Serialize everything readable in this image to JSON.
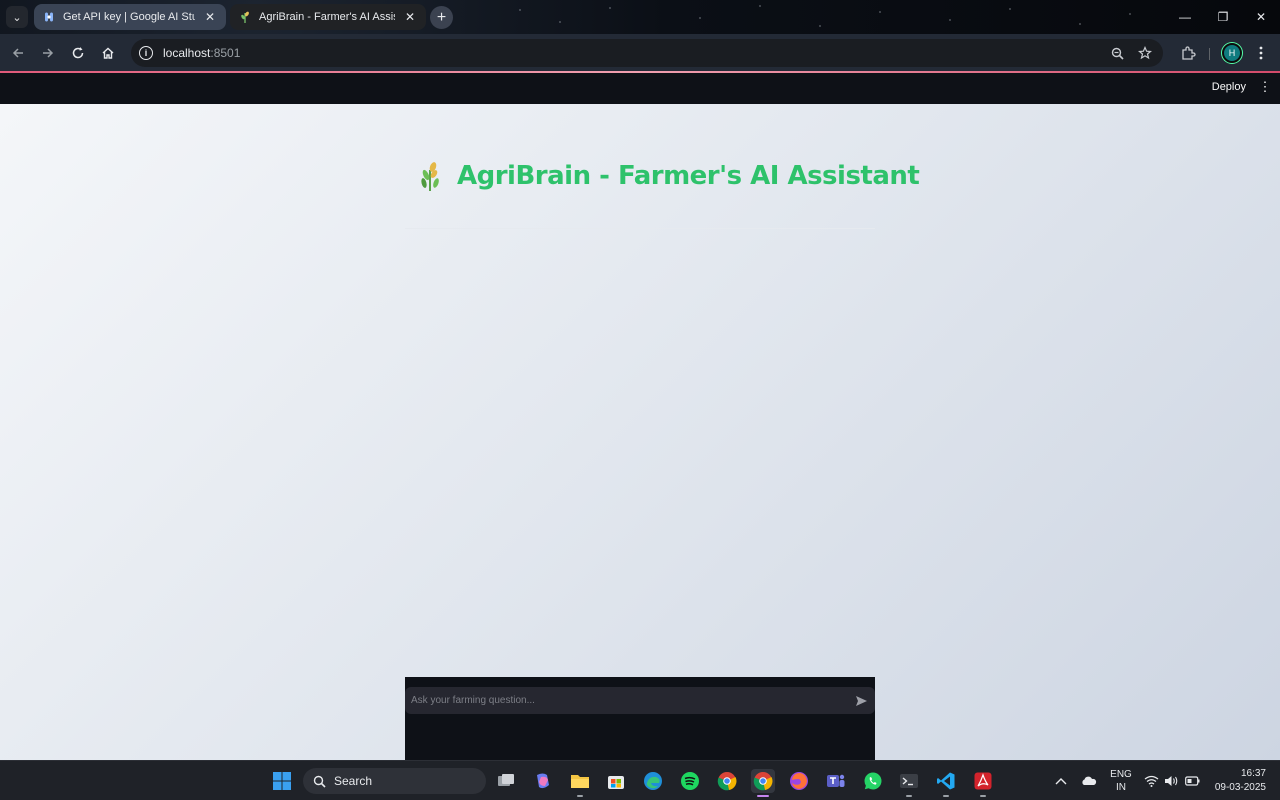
{
  "browser": {
    "tabs": [
      {
        "title": "Get API key | Google AI Studio",
        "close": "✕"
      },
      {
        "title": "AgriBrain - Farmer's AI Assistant",
        "close": "✕"
      }
    ],
    "new_tab": "+",
    "tab_search": "⌄",
    "window_controls": {
      "minimize": "—",
      "maximize": "❐",
      "close": "✕"
    },
    "url_host": "localhost",
    "url_port": ":8501",
    "profile_initial": "H"
  },
  "app": {
    "deploy_label": "Deploy",
    "menu_icon": "⋮",
    "title": "AgriBrain - Farmer's AI Assistant",
    "chat_placeholder": "Ask your farming question..."
  },
  "taskbar": {
    "search_label": "Search",
    "language": "ENG",
    "region": "IN",
    "time": "16:37",
    "date": "09-03-2025"
  },
  "colors": {
    "title_green": "#2ec26b",
    "app_dark": "#0e1117",
    "chat_input_bg": "#262730"
  }
}
